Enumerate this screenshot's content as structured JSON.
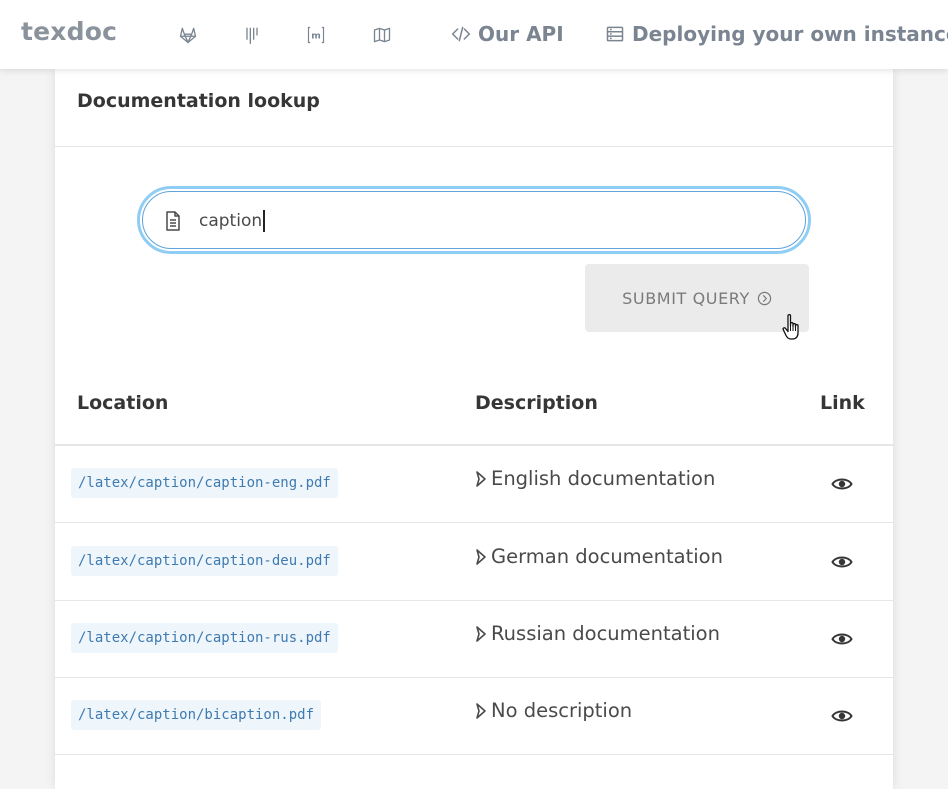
{
  "nav": {
    "brand": "texdoc",
    "icons": [
      "gitlab-icon",
      "ctan-icon",
      "matrix-icon",
      "map-icon"
    ],
    "api_label": "Our API",
    "deploy_label": "Deploying your own instance"
  },
  "card": {
    "title": "Documentation lookup"
  },
  "search": {
    "value": "caption"
  },
  "submit": {
    "label": "SUBMIT QUERY"
  },
  "table": {
    "headers": [
      "Location",
      "Description",
      "Link"
    ],
    "rows": [
      {
        "location": "/latex/caption/caption-eng.pdf",
        "description": "English documentation"
      },
      {
        "location": "/latex/caption/caption-deu.pdf",
        "description": "German documentation"
      },
      {
        "location": "/latex/caption/caption-rus.pdf",
        "description": "Russian documentation"
      },
      {
        "location": "/latex/caption/bicaption.pdf",
        "description": "No description"
      }
    ]
  },
  "colors": {
    "brand": "#8a929b",
    "focus_ring": "#8fcdf5",
    "code_bg": "#eef6fc",
    "code_text": "#3f7ab0"
  }
}
